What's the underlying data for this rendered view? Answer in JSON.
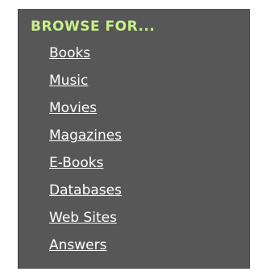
{
  "panel": {
    "title": "BROWSE FOR...",
    "links": [
      {
        "label": "Books"
      },
      {
        "label": "Music"
      },
      {
        "label": "Movies"
      },
      {
        "label": "Magazines"
      },
      {
        "label": "E-Books"
      },
      {
        "label": "Databases"
      },
      {
        "label": "Web Sites"
      },
      {
        "label": "Answers"
      }
    ]
  },
  "colors": {
    "panel_background": "#575757",
    "title": "#c8f08c",
    "link": "#ffffff"
  }
}
